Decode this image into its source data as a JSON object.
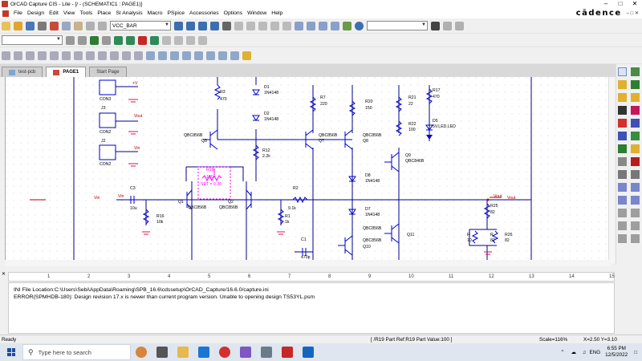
{
  "window": {
    "title": "OrCAD Capture CIS - Lite - [/ - (SCHEMATIC1 : PAGE1)]"
  },
  "menubar": {
    "items": [
      "File",
      "Design",
      "Edit",
      "View",
      "Tools",
      "Place",
      "SI Analysis",
      "Macro",
      "PSpice",
      "Accessories",
      "Options",
      "Window",
      "Help"
    ],
    "brand": "cādence"
  },
  "toolbar": {
    "net_combo_value": "VCC_BAR",
    "search_combo_value": ""
  },
  "tabs": [
    {
      "label": "test-pcb",
      "active": false
    },
    {
      "label": "PAGE1",
      "active": true
    },
    {
      "label": "Start Page",
      "active": false
    }
  ],
  "schematic": {
    "labels": [
      {
        "t": "CON3"
      },
      {
        "t": "J3"
      },
      {
        "t": "CON2"
      },
      {
        "t": "J2"
      },
      {
        "t": "CON2"
      },
      {
        "t": "Vout"
      },
      {
        "t": "Vin"
      },
      {
        "t": "+V"
      },
      {
        "t": "R3"
      },
      {
        "t": "470"
      },
      {
        "t": "D1"
      },
      {
        "t": "1N4148"
      },
      {
        "t": "D2"
      },
      {
        "t": "1N4148"
      },
      {
        "t": "R7"
      },
      {
        "t": "220"
      },
      {
        "t": "R20"
      },
      {
        "t": "150"
      },
      {
        "t": "R21"
      },
      {
        "t": "22"
      },
      {
        "t": "R17"
      },
      {
        "t": "470"
      },
      {
        "t": "R22"
      },
      {
        "t": "100"
      },
      {
        "t": "D5"
      },
      {
        "t": "5V.LED.LED"
      },
      {
        "t": "QBC856B"
      },
      {
        "t": "Q3"
      },
      {
        "t": "QBC856B"
      },
      {
        "t": "Q7"
      },
      {
        "t": "QBC856B"
      },
      {
        "t": "Q8"
      },
      {
        "t": "R12"
      },
      {
        "t": "2.2k"
      },
      {
        "t": "Q9"
      },
      {
        "t": "QBC846B"
      },
      {
        "t": "D8"
      },
      {
        "t": "1N4148"
      },
      {
        "t": "D7"
      },
      {
        "t": "1N4148"
      },
      {
        "t": "Vin"
      },
      {
        "t": "C3"
      },
      {
        "t": "Vin"
      },
      {
        "t": "10u"
      },
      {
        "t": "R19"
      },
      {
        "t": "100"
      },
      {
        "t": "SET = 0.36"
      },
      {
        "t": "Q1"
      },
      {
        "t": "QBC856B"
      },
      {
        "t": "Q2"
      },
      {
        "t": "QBC856B"
      },
      {
        "t": "R16"
      },
      {
        "t": "10k"
      },
      {
        "t": "R2"
      },
      {
        "t": "9.1k"
      },
      {
        "t": "R1"
      },
      {
        "t": "1k"
      },
      {
        "t": "Vout"
      },
      {
        "t": "Vout"
      },
      {
        "t": "R25"
      },
      {
        "t": "82"
      },
      {
        "t": "QBC856B"
      },
      {
        "t": "Q11"
      },
      {
        "t": "C1"
      },
      {
        "t": "470p"
      },
      {
        "t": "QBC856B"
      },
      {
        "t": "Q10"
      },
      {
        "t": "R"
      },
      {
        "t": "10"
      },
      {
        "t": "R"
      },
      {
        "t": "82"
      },
      {
        "t": "R26"
      },
      {
        "t": "82"
      }
    ]
  },
  "ruler": {
    "numbers": [
      "1",
      "2",
      "3",
      "4",
      "5",
      "6",
      "7",
      "8",
      "9",
      "10",
      "11",
      "12",
      "13",
      "14",
      "15"
    ]
  },
  "console": {
    "lines": [
      "INI File Location:C:\\Users\\Sebi\\AppData\\Roaming\\SPB_16.6\\cdssetup\\OrCAD_Capture/16.6.0/capture.ini",
      "ERROR(SPMHDB-180): Design revision 17.x is newer than current program version. Unable to opening design TS53YL.psm"
    ]
  },
  "status": {
    "ready": "Ready",
    "part": "[ /R19 Part Ref:R19 Part Value:100 ]",
    "scale": "Scale=116%",
    "coords": "X=2.50  Y=3.10"
  },
  "taskbar": {
    "search_placeholder": "Type here to search",
    "language": "ENG",
    "time": "6:55 PM",
    "date": "12/5/2022"
  },
  "colors": {
    "wire": "#00008b",
    "ground": "#d4145a",
    "component": "#0000cd",
    "highlight": "#ff00ff",
    "net_label": "#b30000"
  }
}
